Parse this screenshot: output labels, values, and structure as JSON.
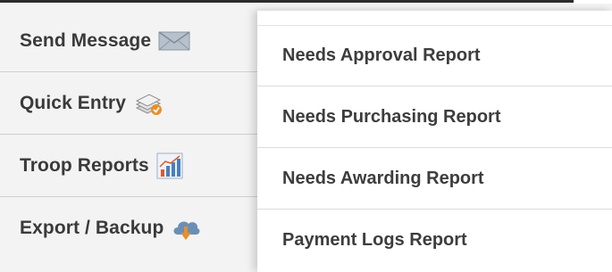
{
  "left_menu": {
    "items": [
      {
        "label": "Send Message",
        "icon": "envelope-icon"
      },
      {
        "label": "Quick Entry",
        "icon": "paper-stack-check-icon"
      },
      {
        "label": "Troop Reports",
        "icon": "bar-chart-icon"
      },
      {
        "label": "Export / Backup",
        "icon": "cloud-download-icon"
      }
    ]
  },
  "submenu": {
    "items": [
      {
        "label": "Needs Approval Report"
      },
      {
        "label": "Needs Purchasing Report"
      },
      {
        "label": "Needs Awarding Report"
      },
      {
        "label": "Payment Logs Report"
      }
    ]
  },
  "colors": {
    "text": "#3a3a3a",
    "menu_bg": "#f3f3f3",
    "submenu_bg": "#ffffff",
    "divider": "#cfcfcf",
    "accent_orange": "#e8902a",
    "icon_blue": "#6a8fb5"
  }
}
